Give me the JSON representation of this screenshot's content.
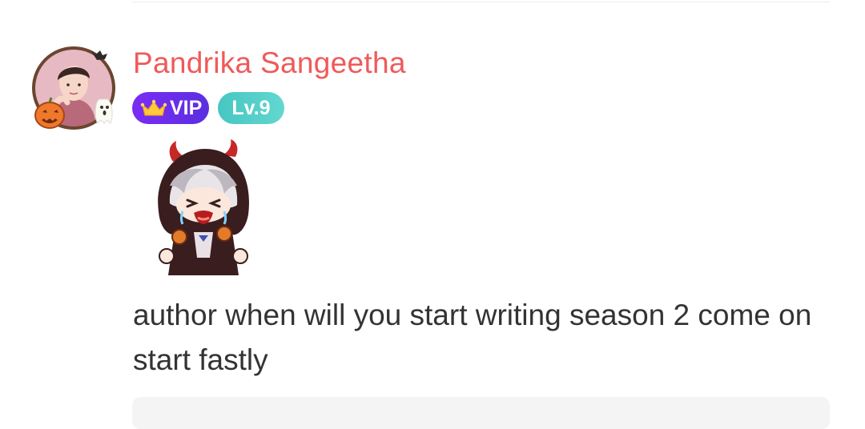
{
  "comment": {
    "author_name": "Pandrika Sangeetha",
    "vip_label": "VIP",
    "level_label": "Lv.9",
    "text": "author when will you start writing season 2 come on start fastly"
  },
  "icons": {
    "avatar_frame": "halloween-frame-icon",
    "vip_crown": "crown-icon",
    "sticker": "crying-devil-girl-sticker"
  },
  "colors": {
    "author_name": "#ef5a5a",
    "vip_badge": "#6a2ff0",
    "level_badge": "#4fcac4",
    "comment_text": "#333333",
    "reply_box": "#f4f4f4"
  }
}
